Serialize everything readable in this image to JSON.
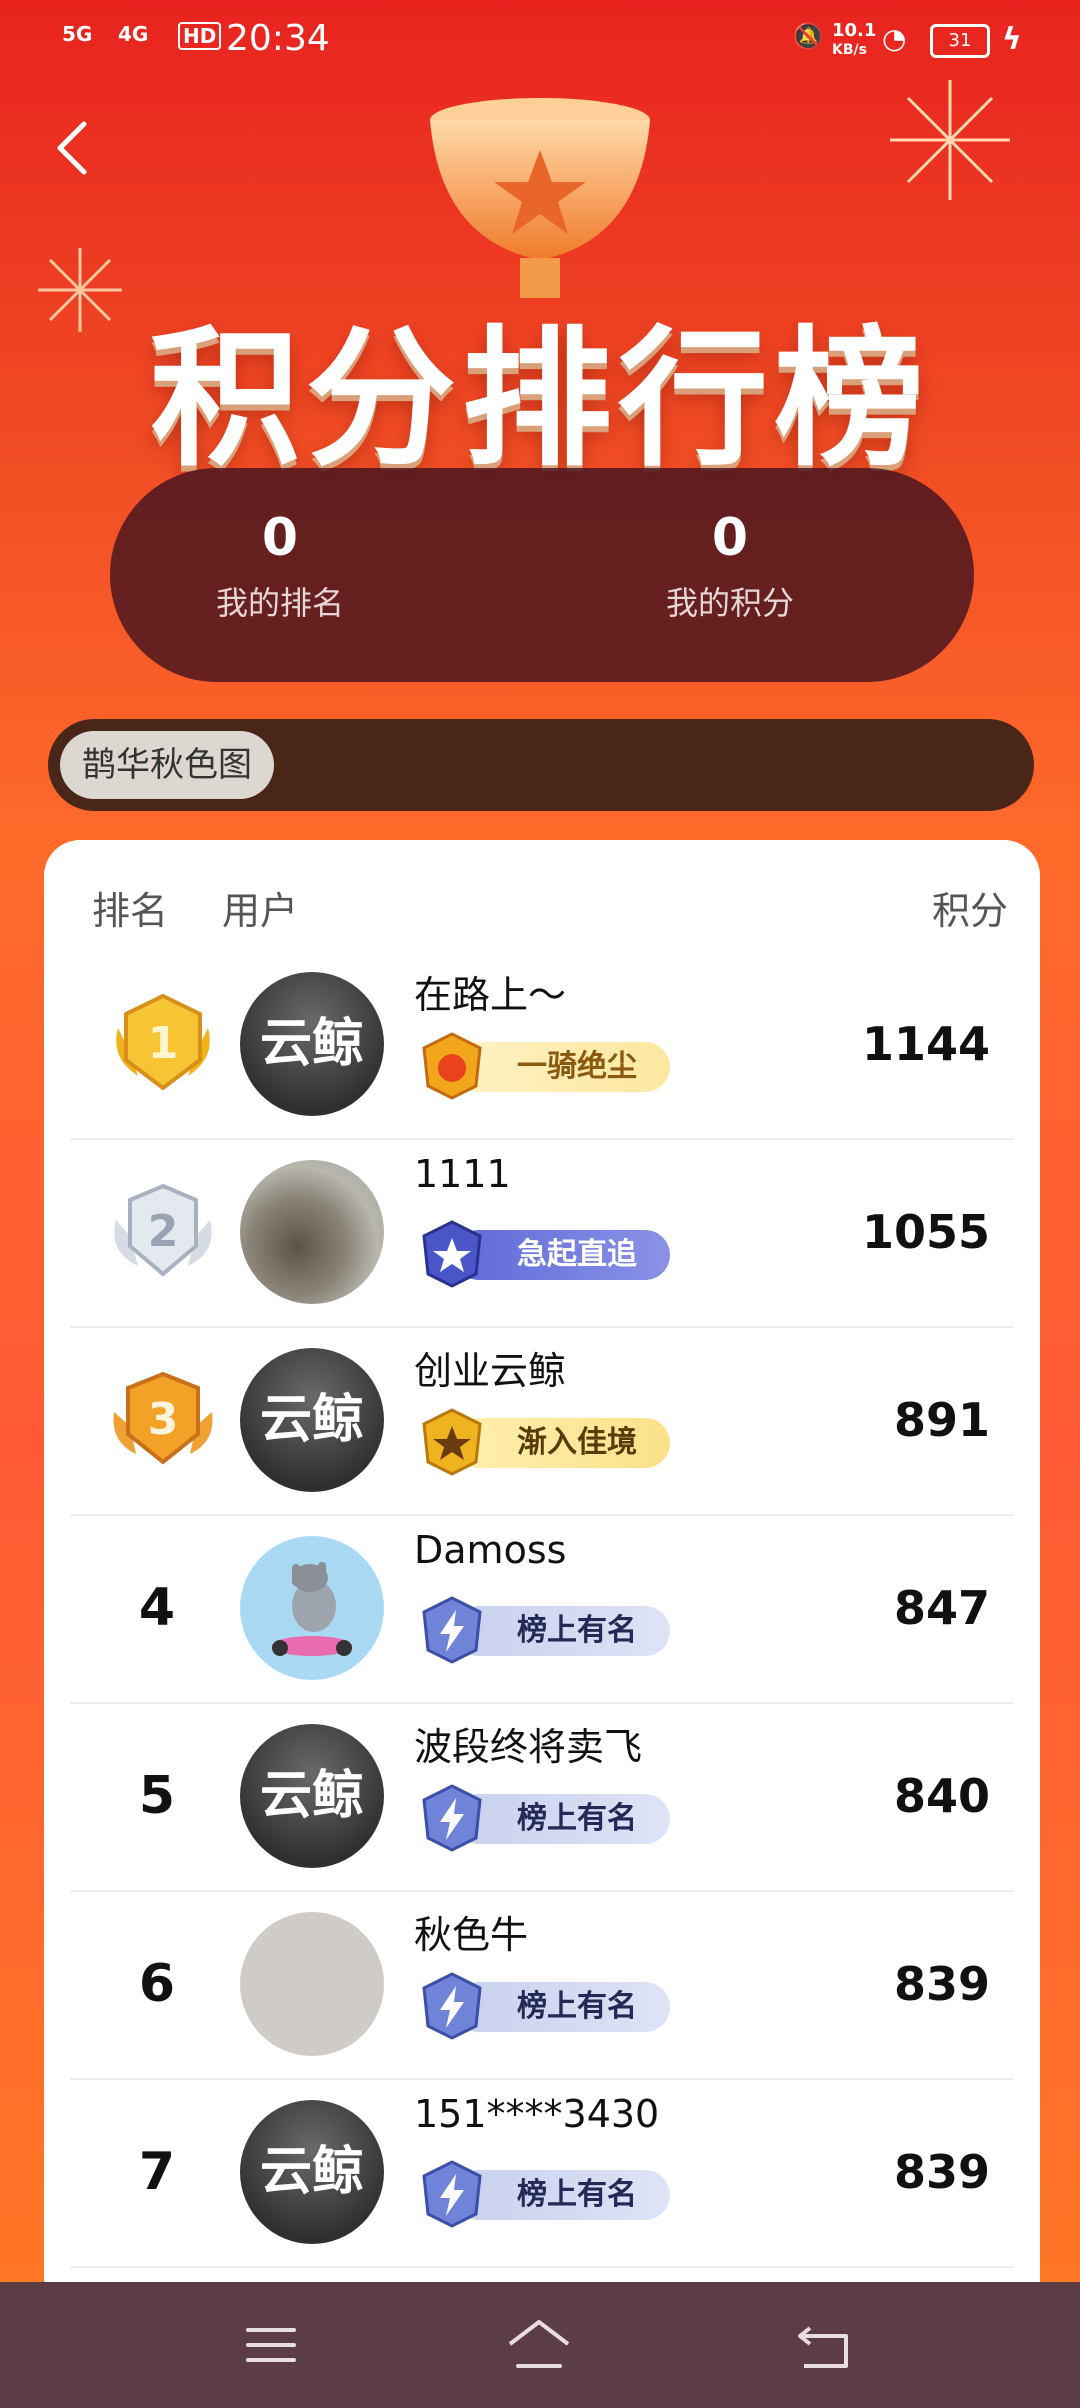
{
  "status": {
    "time": "20:34",
    "sig1": "5G",
    "sig2": "4G",
    "hd": "HD",
    "speed": "10.1",
    "speed_unit": "KB/s",
    "battery": "31"
  },
  "page": {
    "title": "积分排行榜"
  },
  "my": {
    "rank_value": "0",
    "rank_label": "我的排名",
    "points_value": "0",
    "points_label": "我的积分"
  },
  "category": {
    "selected": "鹊华秋色图"
  },
  "table": {
    "col_rank": "排名",
    "col_user": "用户",
    "col_points": "积分"
  },
  "rows": [
    {
      "rank": "1",
      "name": "在路上～",
      "avatar": "云鲸",
      "badge": "一骑绝尘",
      "score": "1144"
    },
    {
      "rank": "2",
      "name": "1111",
      "avatar": "",
      "badge": "急起直追",
      "score": "1055"
    },
    {
      "rank": "3",
      "name": "创业云鲸",
      "avatar": "云鲸",
      "badge": "渐入佳境",
      "score": "891"
    },
    {
      "rank": "4",
      "name": "Damoss",
      "avatar": "",
      "badge": "榜上有名",
      "score": "847"
    },
    {
      "rank": "5",
      "name": "波段终将卖飞",
      "avatar": "云鲸",
      "badge": "榜上有名",
      "score": "840"
    },
    {
      "rank": "6",
      "name": "秋色牛",
      "avatar": "",
      "badge": "榜上有名",
      "score": "839"
    },
    {
      "rank": "7",
      "name": "151****3430",
      "avatar": "云鲸",
      "badge": "榜上有名",
      "score": "839"
    }
  ],
  "colors": {
    "accent": "#e8231f",
    "gold": "#f5b316",
    "silver": "#c7ccd6",
    "bronze": "#e98a1e",
    "badge_blue": "#7b86d6"
  }
}
